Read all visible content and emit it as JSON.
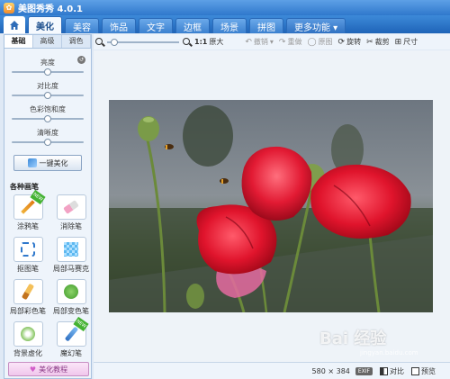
{
  "titlebar": {
    "title": "美图秀秀 4.0.1"
  },
  "nav": {
    "tabs": [
      "美化",
      "美容",
      "饰品",
      "文字",
      "边框",
      "场景",
      "拼图"
    ],
    "more": "更多功能 ▾"
  },
  "left": {
    "subtabs": [
      "基础",
      "高级",
      "调色"
    ],
    "sliders": [
      {
        "label": "亮度",
        "value": 0.5
      },
      {
        "label": "对比度",
        "value": 0.5
      },
      {
        "label": "色彩饱和度",
        "value": 0.5
      },
      {
        "label": "清晰度",
        "value": 0.5
      }
    ],
    "oneclick": "一键美化",
    "brushes_title": "各种画笔",
    "brushes": [
      "涂鸦笔",
      "消除笔",
      "抠图笔",
      "局部马赛克",
      "局部彩色笔",
      "局部变色笔",
      "背景虚化",
      "魔幻笔"
    ],
    "tutorial": "美化教程"
  },
  "toolbar": {
    "zoom_value": 0.1,
    "actual_size": "原大",
    "ratio": "1:1",
    "undo": "撤销",
    "redo": "重做",
    "original": "原图",
    "rotate": "旋转",
    "crop": "裁剪",
    "resize": "尺寸"
  },
  "status": {
    "dims": "580 × 384",
    "exif": "EXIF",
    "compare": "对比",
    "preview": "预览"
  },
  "watermark": {
    "main": "Bai 经验",
    "sub": "jingyan.baidu.com"
  }
}
